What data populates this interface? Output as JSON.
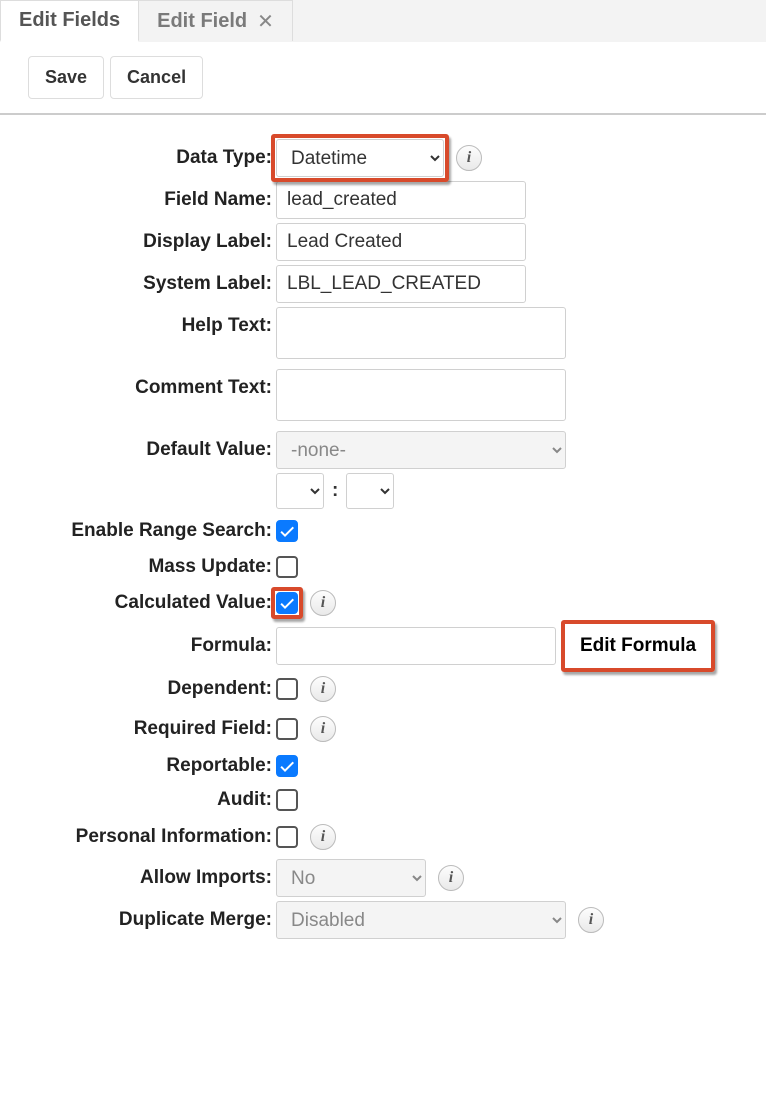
{
  "tabs": {
    "edit_fields": "Edit Fields",
    "edit_field": "Edit Field"
  },
  "toolbar": {
    "save": "Save",
    "cancel": "Cancel"
  },
  "labels": {
    "data_type": "Data Type:",
    "field_name": "Field Name:",
    "display_label": "Display Label:",
    "system_label": "System Label:",
    "help_text": "Help Text:",
    "comment_text": "Comment Text:",
    "default_value": "Default Value:",
    "enable_range_search": "Enable Range Search:",
    "mass_update": "Mass Update:",
    "calculated_value": "Calculated Value:",
    "formula": "Formula:",
    "dependent": "Dependent:",
    "required_field": "Required Field:",
    "reportable": "Reportable:",
    "audit": "Audit:",
    "personal_information": "Personal Information:",
    "allow_imports": "Allow Imports:",
    "duplicate_merge": "Duplicate Merge:"
  },
  "values": {
    "data_type": "Datetime",
    "field_name": "lead_created",
    "display_label": "Lead Created",
    "system_label": "LBL_LEAD_CREATED",
    "help_text": "",
    "comment_text": "",
    "default_value": "-none-",
    "time_hour": "",
    "time_minute": "",
    "enable_range_search": true,
    "mass_update": false,
    "calculated_value": true,
    "formula": "",
    "dependent": false,
    "required_field": false,
    "reportable": true,
    "audit": false,
    "personal_information": false,
    "allow_imports": "No",
    "duplicate_merge": "Disabled"
  },
  "buttons": {
    "edit_formula": "Edit Formula"
  }
}
